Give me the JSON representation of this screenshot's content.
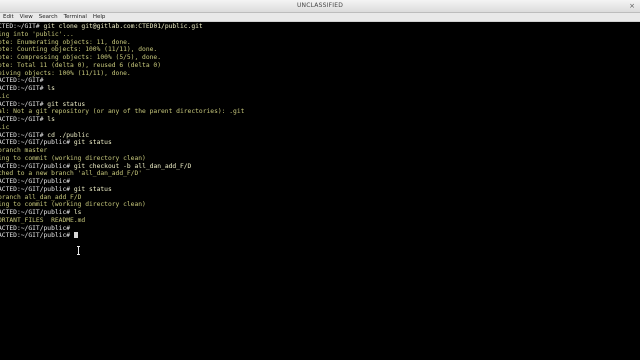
{
  "window": {
    "title": "UNCLASSIFIED",
    "close_glyph": "×"
  },
  "menubar": {
    "items": [
      "Edit",
      "View",
      "Search",
      "Terminal",
      "Help"
    ]
  },
  "terminal": {
    "lines": [
      {
        "kind": "cmd",
        "prompt": "CTED:~/GIT# ",
        "text": "git clone git@gitlab.com:CTED01/public.git"
      },
      {
        "kind": "out",
        "text": "ing into 'public'..."
      },
      {
        "kind": "out",
        "text": "ote: Enumerating objects: 11, done."
      },
      {
        "kind": "out",
        "text": "ote: Counting objects: 100% (11/11), done."
      },
      {
        "kind": "out",
        "text": "ote: Compressing objects: 100% (5/5), done."
      },
      {
        "kind": "out",
        "text": "ote: Total 11 (delta 0), reused 6 (delta 0)"
      },
      {
        "kind": "out",
        "text": "eiving objects: 100% (11/11), done."
      },
      {
        "kind": "cmd",
        "prompt": "ACTED:~/GIT# ",
        "text": ""
      },
      {
        "kind": "cmd",
        "prompt": "ACTED:~/GIT# ",
        "text": "ls"
      },
      {
        "kind": "out",
        "text": "lic"
      },
      {
        "kind": "cmd",
        "prompt": "ACTED:~/GIT# ",
        "text": "git status"
      },
      {
        "kind": "out",
        "text": "al: Not a git repository (or any of the parent directories): .git"
      },
      {
        "kind": "cmd",
        "prompt": "ACTED:~/GIT# ",
        "text": "ls"
      },
      {
        "kind": "out",
        "text": "lic"
      },
      {
        "kind": "cmd",
        "prompt": "ACTED:~/GIT# ",
        "text": "cd ./public"
      },
      {
        "kind": "cmd",
        "prompt": "ACTED:~/GIT/public# ",
        "text": "git status"
      },
      {
        "kind": "out",
        "text": "branch master"
      },
      {
        "kind": "out",
        "text": "ing to commit (working directory clean)"
      },
      {
        "kind": "cmd",
        "prompt": "ACTED:~/GIT/public# ",
        "text": "git checkout -b all_dan_add_F/D"
      },
      {
        "kind": "out",
        "text": "ched to a new branch 'all_dan_add_F/D'"
      },
      {
        "kind": "cmd",
        "prompt": "ACTED:~/GIT/public# ",
        "text": ""
      },
      {
        "kind": "cmd",
        "prompt": "ACTED:~/GIT/public# ",
        "text": "git status"
      },
      {
        "kind": "out",
        "text": "branch all_dan_add_F/D"
      },
      {
        "kind": "out",
        "text": "ing to commit (working directory clean)"
      },
      {
        "kind": "cmd",
        "prompt": "ACTED:~/GIT/public# ",
        "text": "ls"
      },
      {
        "kind": "out",
        "text": "ORTANT_FILES  README.md"
      },
      {
        "kind": "cmd",
        "prompt": "ACTED:~/GIT/public# ",
        "text": ""
      },
      {
        "kind": "cmd",
        "prompt": "ACTED:~/GIT/public# ",
        "text": "",
        "cursor": true
      }
    ]
  }
}
